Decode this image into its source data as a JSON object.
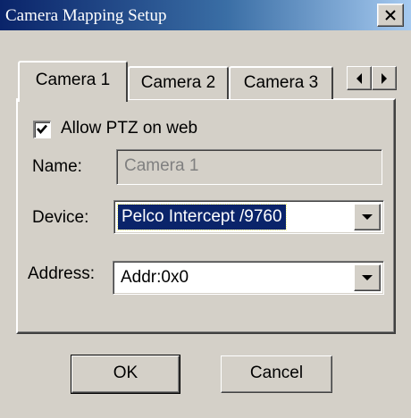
{
  "window": {
    "title": "Camera Mapping Setup",
    "close_icon": "close-icon"
  },
  "tabs": {
    "items": [
      {
        "label": "Camera 1",
        "active": true
      },
      {
        "label": "Camera 2",
        "active": false
      },
      {
        "label": "Camera 3",
        "active": false
      }
    ],
    "scroll_icons": [
      "chevron-left-icon",
      "chevron-right-icon"
    ]
  },
  "form": {
    "allow_ptz": {
      "label": "Allow PTZ on web",
      "checked": true
    },
    "name": {
      "label": "Name:",
      "value": "Camera 1",
      "enabled": false
    },
    "device": {
      "label": "Device:",
      "value": "Pelco Intercept /9760"
    },
    "address": {
      "label": "Address:",
      "value": "Addr:0x0"
    }
  },
  "buttons": {
    "ok": "OK",
    "cancel": "Cancel"
  },
  "colors": {
    "title_start": "#0a246a",
    "title_end": "#a6caf0",
    "face": "#d4d0c8",
    "selection": "#0a246a"
  }
}
